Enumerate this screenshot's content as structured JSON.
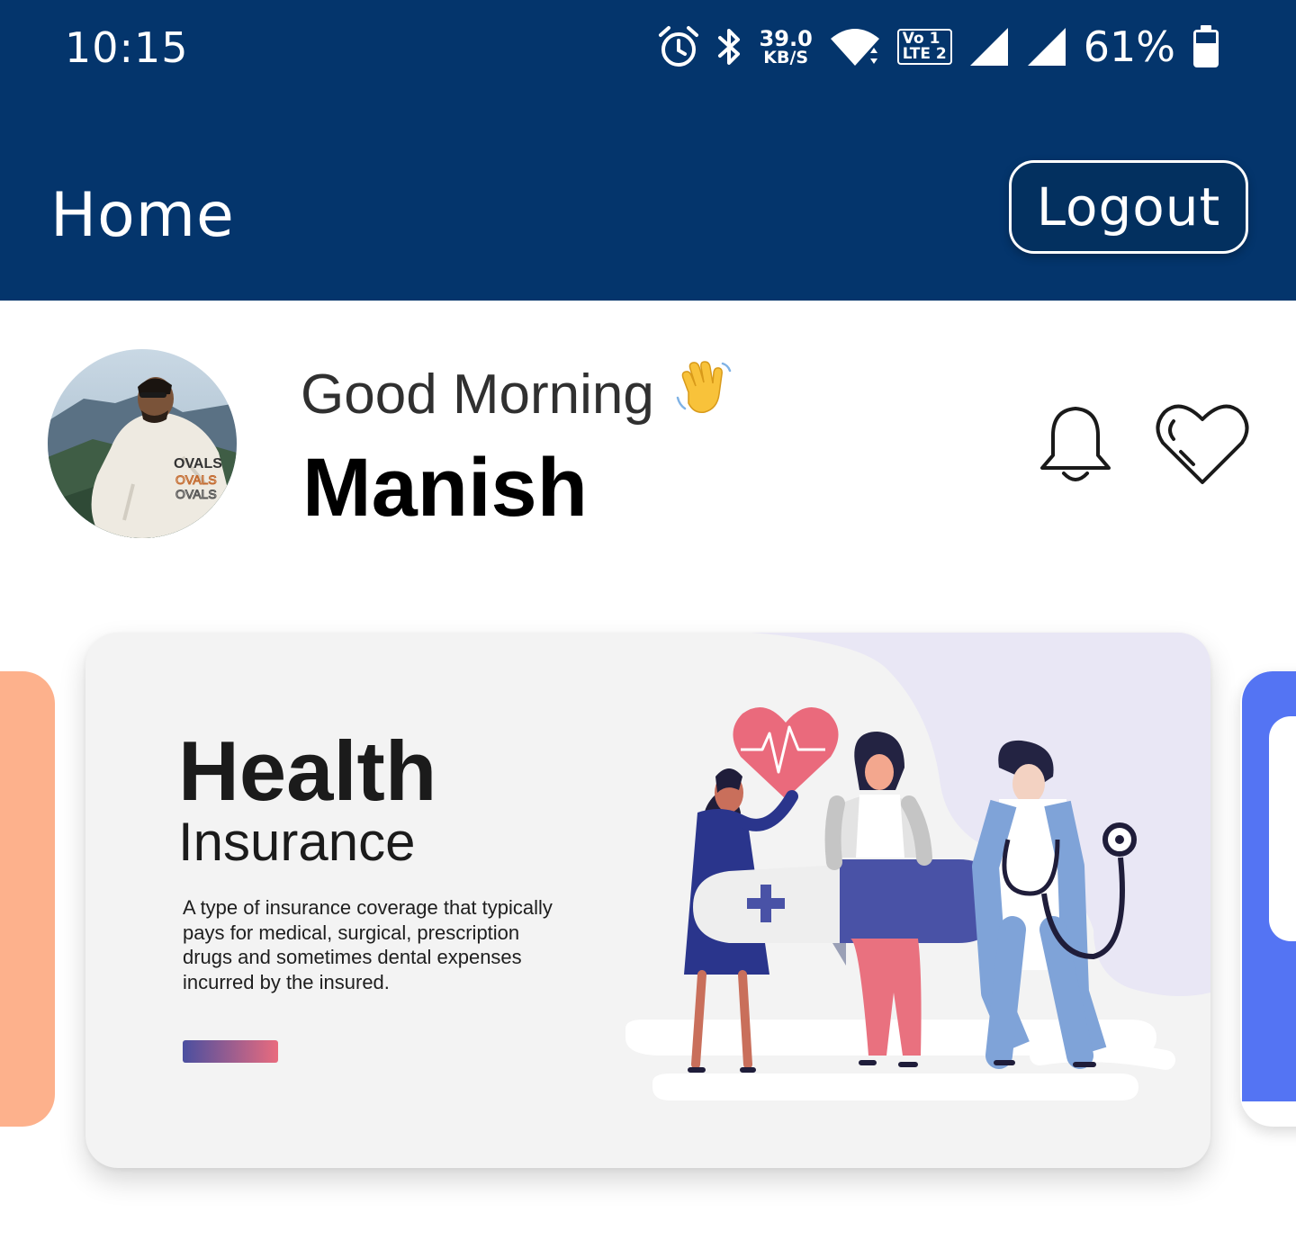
{
  "status_bar": {
    "time": "10:15",
    "net_speed_value": "39.0",
    "net_speed_unit": "KB/S",
    "volte_top": "Vo 1",
    "volte_bottom": "LTE 2",
    "battery_percent": "61%",
    "icons": [
      "alarm-icon",
      "bluetooth-icon",
      "wifi-icon",
      "volte-icon",
      "signal-sim1-icon",
      "signal-sim2-icon",
      "battery-icon"
    ]
  },
  "app_bar": {
    "title": "Home",
    "logout_label": "Logout",
    "background": "#04356c"
  },
  "greeting": {
    "salutation": "Good Morning",
    "emoji": "👋",
    "user_name": "Manish",
    "actions": [
      "bell-icon",
      "heart-icon"
    ]
  },
  "carousel": {
    "current_card": {
      "title": "Health",
      "subtitle": "Insurance",
      "description": "A type of insurance coverage that typically\npays for medical, surgical, prescription\ndrugs and sometimes dental expenses\n incurred by the insured."
    },
    "colors": {
      "left_card": "#fdb18c",
      "right_card": "#5474f3",
      "bar_start": "#4a4fa0",
      "bar_end": "#e96b7e"
    }
  }
}
